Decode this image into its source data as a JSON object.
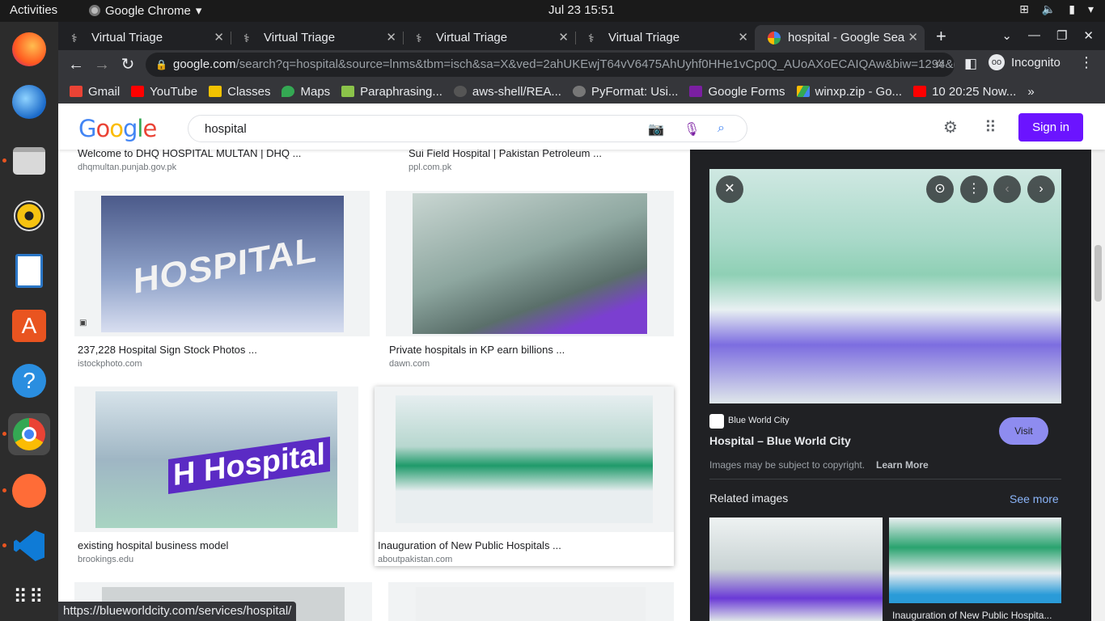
{
  "system": {
    "activities": "Activities",
    "app_name": "Google Chrome",
    "clock": "Jul 23  15:51"
  },
  "tabs": [
    {
      "label": "Virtual Triage"
    },
    {
      "label": "Virtual Triage"
    },
    {
      "label": "Virtual Triage"
    },
    {
      "label": "Virtual Triage"
    },
    {
      "label": "hospital - Google Sear"
    }
  ],
  "omnibox": {
    "host": "google.com",
    "path": "/search?q=hospital&source=lnms&tbm=isch&sa=X&ved=2ahUKEwjT64vV6475AhUyhf0HHe1vCp0Q_AUoAXoECAIQAw&biw=1294&b..."
  },
  "profile": {
    "label": "Incognito"
  },
  "bookmarks": [
    {
      "label": "Gmail",
      "color": "#ea4335"
    },
    {
      "label": "YouTube",
      "color": "#ff0000"
    },
    {
      "label": "Classes",
      "color": "#f2c200"
    },
    {
      "label": "Maps",
      "color": "#34a853"
    },
    {
      "label": "Paraphrasing...",
      "color": "#8bc34a"
    },
    {
      "label": "aws-shell/REA...",
      "color": "#555555"
    },
    {
      "label": "PyFormat: Usi...",
      "color": "#777777"
    },
    {
      "label": "Google Forms",
      "color": "#7b1fa2"
    },
    {
      "label": "winxp.zip - Go...",
      "color": "#fbbc04"
    },
    {
      "label": "10 20:25 Now...",
      "color": "#ff0000"
    }
  ],
  "google": {
    "logo": "Google",
    "query": "hospital",
    "signin_label": "Sign in"
  },
  "results": [
    {
      "title": "Welcome to DHQ HOSPITAL MULTAN | DHQ ...",
      "source": "dhqmultan.punjab.gov.pk"
    },
    {
      "title": "Sui Field Hospital | Pakistan Petroleum ...",
      "source": "ppl.com.pk"
    },
    {
      "title": "237,228 Hospital Sign Stock Photos ...",
      "source": "istockphoto.com",
      "thumb_text": "HOSPITAL"
    },
    {
      "title": "Private hospitals in KP earn billions ...",
      "source": "dawn.com"
    },
    {
      "title": "existing hospital business model",
      "source": "brookings.edu",
      "thumb_text": "H Hospital"
    },
    {
      "title": "Inauguration of New Public Hospitals ...",
      "source": "aboutpakistan.com"
    }
  ],
  "preview": {
    "site_name": "Blue World City",
    "title": "Hospital – Blue World City",
    "visit_label": "Visit",
    "copyright": "Images may be subject to copyright.",
    "learn_more": "Learn More",
    "related_heading": "Related images",
    "see_more": "See more",
    "related_caption": "Inauguration of New Public Hospita..."
  },
  "status_url": "https://blueworldcity.com/services/hospital/"
}
